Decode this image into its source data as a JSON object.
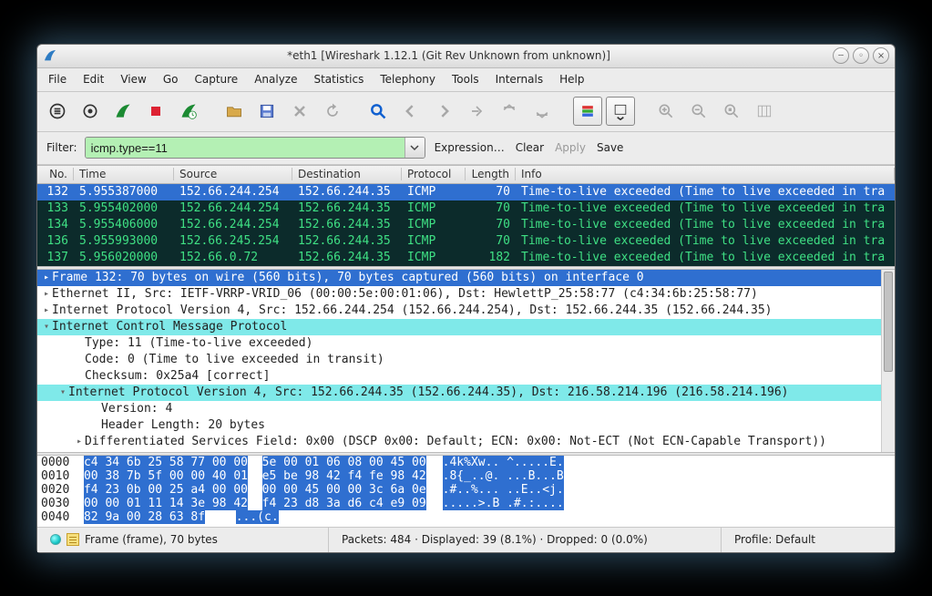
{
  "titlebar": {
    "title": "*eth1    [Wireshark 1.12.1  (Git Rev Unknown from unknown)]"
  },
  "menu": {
    "items": [
      "File",
      "Edit",
      "View",
      "Go",
      "Capture",
      "Analyze",
      "Statistics",
      "Telephony",
      "Tools",
      "Internals",
      "Help"
    ]
  },
  "filter": {
    "label": "Filter:",
    "value": "icmp.type==11",
    "links": {
      "expression": "Expression…",
      "clear": "Clear",
      "apply": "Apply",
      "save": "Save"
    }
  },
  "packet_list": {
    "columns": [
      "No.",
      "Time",
      "Source",
      "Destination",
      "Protocol",
      "Length",
      "Info"
    ],
    "rows": [
      {
        "no": "132",
        "time": "5.955387000",
        "src": "152.66.244.254",
        "dst": "152.66.244.35",
        "proto": "ICMP",
        "len": "70",
        "info": "Time-to-live exceeded (Time to live exceeded in tra",
        "selected": true
      },
      {
        "no": "133",
        "time": "5.955402000",
        "src": "152.66.244.254",
        "dst": "152.66.244.35",
        "proto": "ICMP",
        "len": "70",
        "info": "Time-to-live exceeded (Time to live exceeded in tra",
        "selected": false
      },
      {
        "no": "134",
        "time": "5.955406000",
        "src": "152.66.244.254",
        "dst": "152.66.244.35",
        "proto": "ICMP",
        "len": "70",
        "info": "Time-to-live exceeded (Time to live exceeded in tra",
        "selected": false
      },
      {
        "no": "136",
        "time": "5.955993000",
        "src": "152.66.245.254",
        "dst": "152.66.244.35",
        "proto": "ICMP",
        "len": "70",
        "info": "Time-to-live exceeded (Time to live exceeded in tra",
        "selected": false
      },
      {
        "no": "137",
        "time": "5.956020000",
        "src": "152.66.0.72",
        "dst": "152.66.244.35",
        "proto": "ICMP",
        "len": "182",
        "info": "Time-to-live exceeded (Time to live exceeded in tra",
        "selected": false
      }
    ]
  },
  "details": {
    "lines": [
      {
        "text": "Frame 132: 70 bytes on wire (560 bits), 70 bytes captured (560 bits) on interface 0",
        "tw": "▸",
        "indent": 0,
        "style": "sel"
      },
      {
        "text": "Ethernet II, Src: IETF-VRRP-VRID_06 (00:00:5e:00:01:06), Dst: HewlettP_25:58:77 (c4:34:6b:25:58:77)",
        "tw": "▸",
        "indent": 0,
        "style": ""
      },
      {
        "text": "Internet Protocol Version 4, Src: 152.66.244.254 (152.66.244.254), Dst: 152.66.244.35 (152.66.244.35)",
        "tw": "▸",
        "indent": 0,
        "style": ""
      },
      {
        "text": "Internet Control Message Protocol",
        "tw": "▾",
        "indent": 0,
        "style": "hl"
      },
      {
        "text": "Type: 11 (Time-to-live exceeded)",
        "tw": "",
        "indent": 2,
        "style": ""
      },
      {
        "text": "Code: 0 (Time to live exceeded in transit)",
        "tw": "",
        "indent": 2,
        "style": ""
      },
      {
        "text": "Checksum: 0x25a4 [correct]",
        "tw": "",
        "indent": 2,
        "style": ""
      },
      {
        "text": "Internet Protocol Version 4, Src: 152.66.244.35 (152.66.244.35), Dst: 216.58.214.196 (216.58.214.196)",
        "tw": "▾",
        "indent": 1,
        "style": "hl"
      },
      {
        "text": "Version: 4",
        "tw": "",
        "indent": 3,
        "style": ""
      },
      {
        "text": "Header Length: 20 bytes",
        "tw": "",
        "indent": 3,
        "style": ""
      },
      {
        "text": "Differentiated Services Field: 0x00 (DSCP 0x00: Default; ECN: 0x00: Not-ECT (Not ECN-Capable Transport))",
        "tw": "▸",
        "indent": 2,
        "style": ""
      }
    ]
  },
  "hex": {
    "rows": [
      {
        "off": "0000",
        "h1": "c4 34 6b 25 58 77 00 00",
        "h2": "5e 00 01 06 08 00 45 00",
        "a": ".4k%Xw.. ^.....E.",
        "selTo": 32
      },
      {
        "off": "0010",
        "h1": "00 38 7b 5f 00 00 40 01",
        "h2": "e5 be 98 42 f4 fe 98 42",
        "a": ".8{_..@. ...B...B",
        "selTo": 32
      },
      {
        "off": "0020",
        "h1": "f4 23 0b 00 25 a4 00 00",
        "h2": "00 00 45 00 00 3c 6a 0e",
        "a": ".#..%... ..E..<j.",
        "selTo": 32
      },
      {
        "off": "0030",
        "h1": "00 00 01 11 14 3e 98 42",
        "h2": "f4 23 d8 3a d6 c4 e9 09",
        "a": ".....>.B .#.:....",
        "selTo": 32
      },
      {
        "off": "0040",
        "h1": "82 9a 00 28 63 8f",
        "h2": "",
        "a": "...(c.",
        "selTo": 12
      }
    ]
  },
  "status": {
    "frame": "Frame (frame), 70 bytes",
    "packets": "Packets: 484 · Displayed: 39 (8.1%) · Dropped: 0 (0.0%)",
    "profile": "Profile: Default"
  },
  "icons": {
    "list": "list-icon",
    "options": "gear-icon",
    "fin": "shark-fin-icon",
    "stop": "stop-icon",
    "restart": "restart-icon",
    "open": "open-icon",
    "save": "save-icon",
    "close": "close-file-icon",
    "reload": "reload-icon",
    "find": "find-icon",
    "back": "back-icon",
    "fwd": "forward-icon",
    "goto": "goto-icon",
    "top": "go-top-icon",
    "bottom": "go-bottom-icon",
    "colorize": "colorize-icon",
    "autoscroll": "autoscroll-icon",
    "zoomin": "zoom-in-icon",
    "zoomout": "zoom-out-icon",
    "zoom100": "zoom-100-icon",
    "cols": "resize-cols-icon"
  }
}
